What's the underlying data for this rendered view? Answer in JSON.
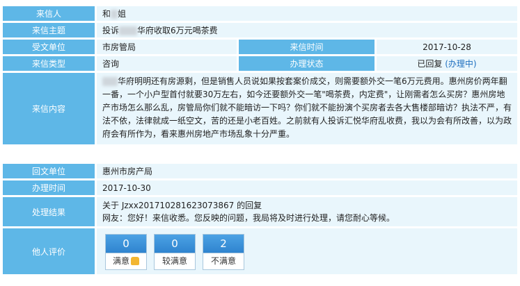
{
  "letter": {
    "sender_label": "来信人",
    "sender_first": "和",
    "sender_last": "姐",
    "subject_label": "来信主题",
    "subject_prefix": "投诉",
    "subject_suffix": "华府收取6万元喝茶费",
    "dept_label": "受文单位",
    "dept_value": "市房管局",
    "date_label": "来信时间",
    "date_value": "2017-10-28",
    "type_label": "来信类型",
    "type_value": "咨询",
    "status_label": "办理状态",
    "status_value": "已回复",
    "status_link": "(办理中)",
    "content_label": "来信内容",
    "content_text": "华府明明还有房源剩，但是销售人员说如果按套案价成交，则需要额外交一笔6万元费用。惠州房价两年翻一番，一个小户型首付就要30万左右，如今还要额外交一笔\"喝茶费，内定费\"，让刚需者怎么买房？惠州房地产市场怎么那么乱，房管局你们就不能暗访一下吗？你们就不能扮演个买房者去各大售楼部暗访？执法不严，有法不依，法律就成一纸空文，苦的还是小老百姓。之前就有人投诉汇悦华府乱收费，我以为会有所改善，以为政府会有所作为，看来惠州房地产市场乱象十分严重。"
  },
  "reply": {
    "unit_label": "回文单位",
    "unit_value": "惠州市房产局",
    "time_label": "办理时间",
    "time_value": "2017-10-30",
    "result_label": "处理结果",
    "result_line1": "关于 Jzxx201710281623073867 的回复",
    "result_line2": "网友：您好！来信收悉。您反映的问题，我局将及时进行处理，请您耐心等候。"
  },
  "evaluation": {
    "label": "他人评价",
    "items": [
      {
        "count": "0",
        "label": "满意"
      },
      {
        "count": "0",
        "label": "较满意"
      },
      {
        "count": "2",
        "label": "不满意"
      }
    ]
  },
  "colors": {
    "label_bg": "#5eb7e7",
    "value_bg": "#e9f6fc",
    "count_bg": "#3a8fd9",
    "link": "#1e6fbf"
  },
  "icons": {
    "satisfied": "thumbs-up-icon"
  }
}
